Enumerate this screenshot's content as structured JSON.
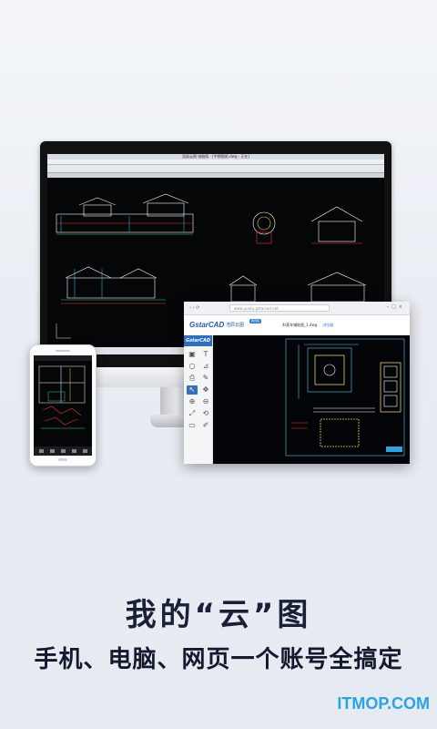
{
  "headline": "我的“云”图",
  "subline": "手机、电脑、网页一个账号全搞定",
  "watermark": "ITMOP.COM",
  "monitor": {
    "window_title": "浩辰云图 电脑版 - [中期图纸.dwg - 正在]"
  },
  "browser": {
    "url": "www.yuntu.gstarcad.net",
    "logo": "GstarCAD",
    "logo_sub": "浩辰云图",
    "badge": "网页版",
    "file_name": "4t蒸车辅助图_1.dwg",
    "file_tag": "浏览器",
    "sidebar_logo": "GstarCAD"
  },
  "colors": {
    "accent": "#2e6fc2",
    "headline": "#1b1f38",
    "watermark": "#2aa3e0",
    "cad_background": "#050608"
  }
}
